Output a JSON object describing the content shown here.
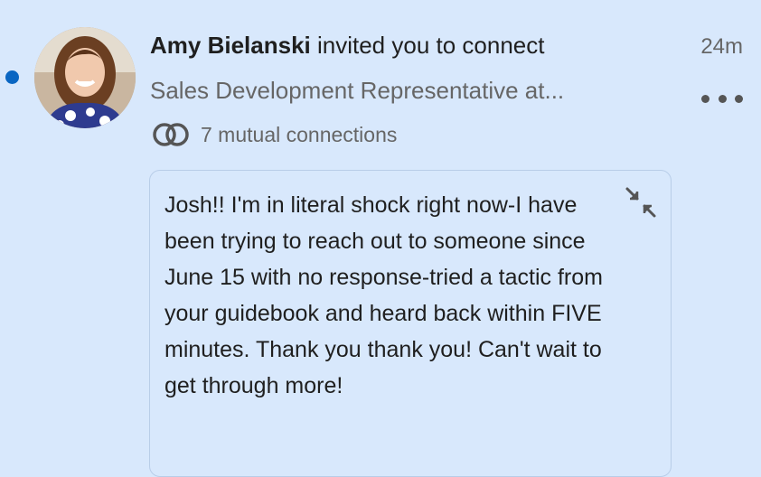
{
  "notification": {
    "name": "Amy Bielanski",
    "action": " invited you to connect",
    "timestamp": "24m",
    "subtitle": "Sales Development Representative at...",
    "mutual_connections": "7 mutual connections",
    "message": "Josh!! I'm in literal shock right now-I have been trying to reach out to someone since June 15 with no response-tried a tactic from your guidebook and heard back within FIVE minutes. Thank you thank you! Can't wait to get through more!"
  },
  "icons": {
    "mutual": "mutual-connections-icon",
    "more": "more-options-icon",
    "collapse": "collapse-icon"
  },
  "colors": {
    "background": "#d8e8fc",
    "unread_dot": "#0a66c2",
    "secondary_text": "#666666",
    "primary_text": "#1f1f1f"
  }
}
